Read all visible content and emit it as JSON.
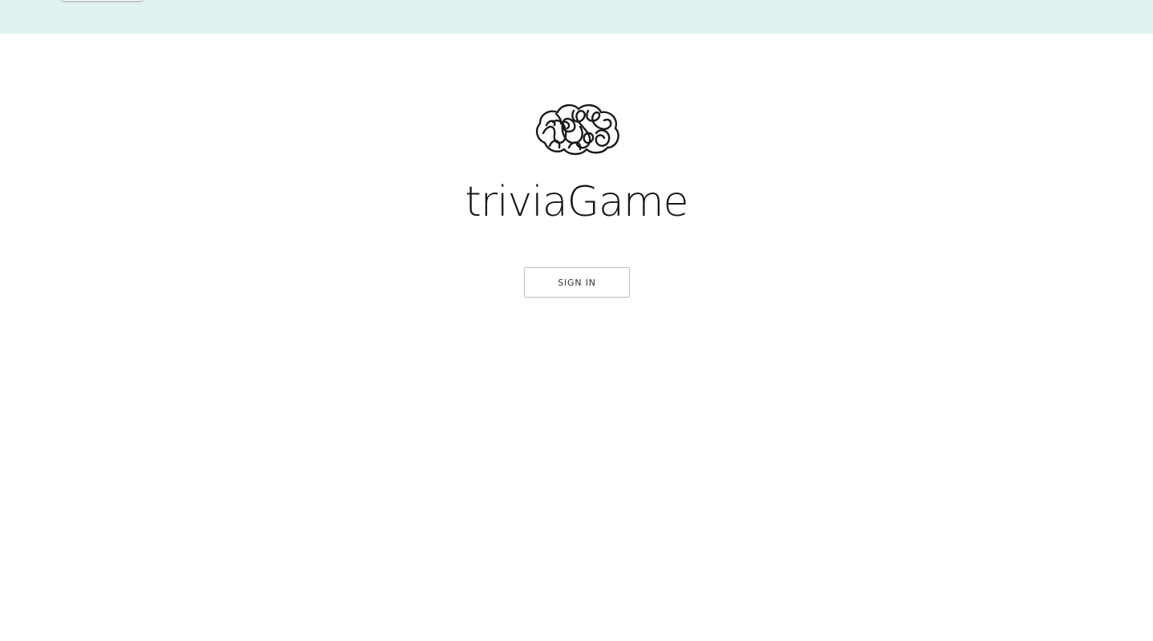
{
  "header": {
    "background_color": "#e0f2f1"
  },
  "logo": {
    "icon": "brain-icon"
  },
  "app": {
    "title": "triviaGame"
  },
  "auth": {
    "sign_in_label": "SIGN IN"
  }
}
